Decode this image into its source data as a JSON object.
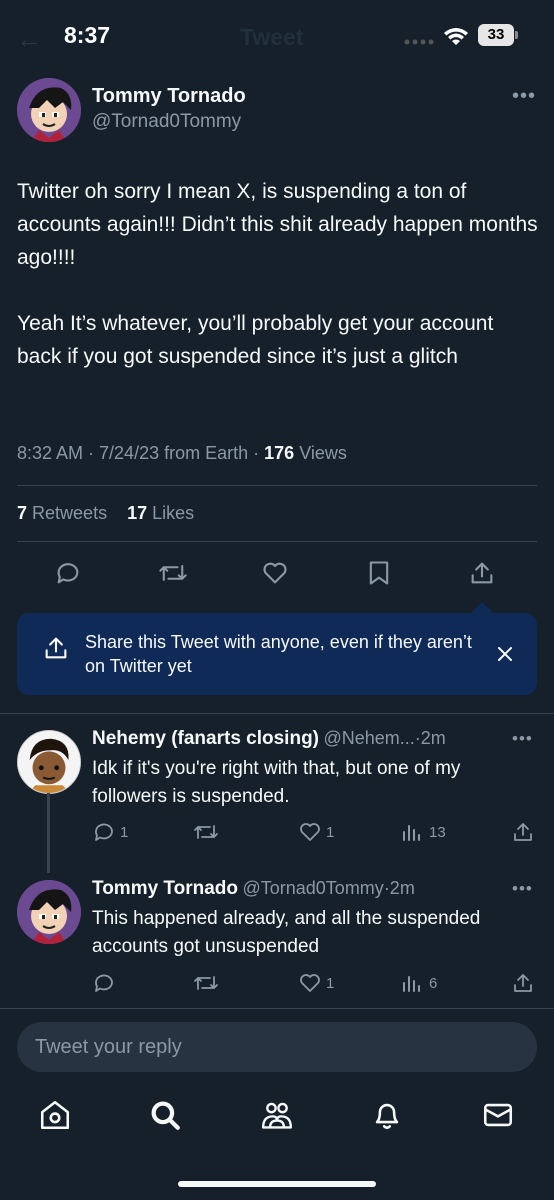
{
  "status": {
    "time": "8:37",
    "battery": "33"
  },
  "header": {
    "title": "Tweet"
  },
  "tweet": {
    "name": "Tommy Tornado",
    "handle": "@Tornad0Tommy",
    "paragraph1": "Twitter oh sorry I mean X, is suspending a ton of accounts again!!! Didn’t this shit already happen months ago!!!!",
    "paragraph2": "Yeah It’s whatever, you’ll probably get your account back if you got suspended since it’s just a glitch",
    "timestamp": "8:32 AM · 7/24/23 from Earth ·",
    "views_count": "176",
    "views_label": "Views",
    "retweets_count": "7",
    "retweets_label": "Retweets",
    "likes_count": "17",
    "likes_label": "Likes"
  },
  "share_banner": {
    "text": "Share this Tweet with anyone, even if they aren’t on Twitter yet"
  },
  "replies": [
    {
      "name": "Nehemy (fanarts closing)",
      "handle": "@Nehem...",
      "time": "·2m",
      "text": "Idk if it's you're right with that, but one of my followers is suspended.",
      "replies": "1",
      "likes": "1",
      "views": "13"
    },
    {
      "name": "Tommy Tornado",
      "handle": "@Tornad0Tommy",
      "time": "·2m",
      "text": "This happened already, and all the suspended accounts got unsuspended",
      "likes": "1",
      "views": "6"
    }
  ],
  "compose": {
    "placeholder": "Tweet your reply"
  },
  "colors": {
    "background": "#15202b",
    "banner": "#0f2a57",
    "muted": "#8b98a5",
    "text": "#f7f9f9",
    "divider": "#38444d"
  },
  "icons": [
    "back-arrow-icon",
    "signal-icon",
    "wifi-icon",
    "battery-icon",
    "more-icon",
    "reply-icon",
    "retweet-icon",
    "like-icon",
    "bookmark-icon",
    "share-icon",
    "close-icon",
    "views-icon",
    "home-icon",
    "search-icon",
    "communities-icon",
    "notifications-icon",
    "messages-icon"
  ]
}
